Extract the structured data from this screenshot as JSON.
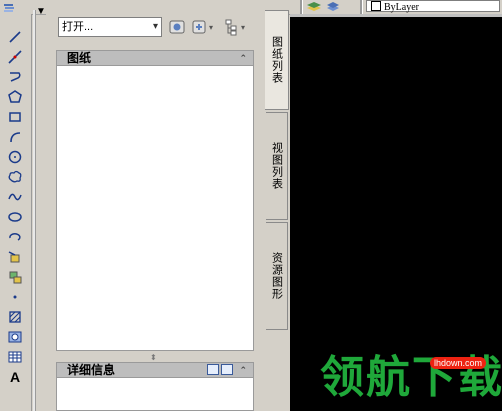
{
  "toolbar": {
    "linetype_value": "ByLayer"
  },
  "palette": {
    "open_combo_value": "打开...",
    "sheets_header": "图纸",
    "details_header": "详细信息",
    "tabs": [
      "图纸列表",
      "视图列表",
      "资源图形"
    ],
    "active_tab": "图纸列表"
  },
  "draw_tools": [
    "line-icon",
    "construction-line-icon",
    "polyline-icon",
    "polygon-icon",
    "rectangle-icon",
    "arc-icon",
    "circle-icon",
    "revision-cloud-icon",
    "spline-icon",
    "ellipse-icon",
    "ellipse-arc-icon",
    "insert-block-icon",
    "make-block-icon",
    "point-icon",
    "hatch-icon",
    "region-icon",
    "table-icon",
    "multiline-text-icon"
  ],
  "draw_tools_text_label": "A",
  "watermark": {
    "text": "领航下载",
    "url": "lhdown.com"
  },
  "colors": {
    "ui_face": "#d4d0c8",
    "canvas": "#000000",
    "watermark_green": "#1fa83a",
    "watermark_red": "#e21111"
  }
}
